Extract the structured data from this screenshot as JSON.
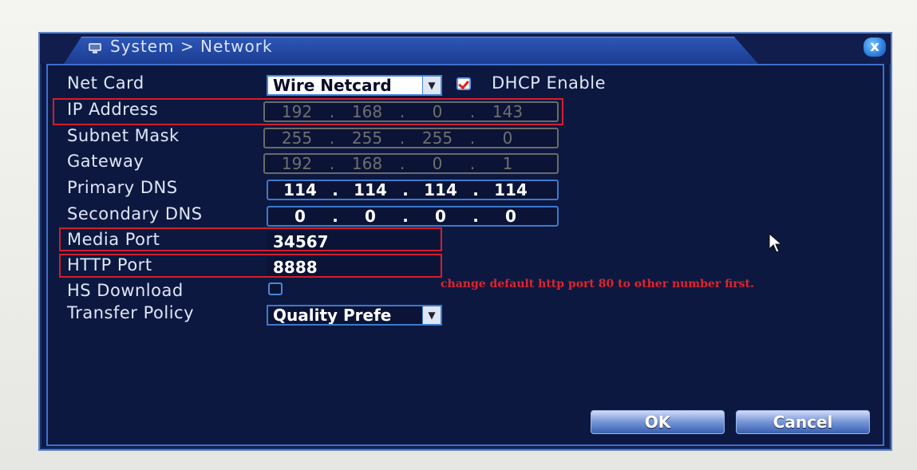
{
  "window": {
    "title": "System > Network",
    "close_label": "x"
  },
  "form": {
    "net_card": {
      "label": "Net Card",
      "value": "Wire Netcard",
      "dhcp_label": "DHCP Enable",
      "dhcp_checked": true
    },
    "ip_address": {
      "label": "IP Address",
      "octets": [
        "192",
        "168",
        "0",
        "143"
      ]
    },
    "subnet_mask": {
      "label": "Subnet Mask",
      "octets": [
        "255",
        "255",
        "255",
        "0"
      ]
    },
    "gateway": {
      "label": "Gateway",
      "octets": [
        "192",
        "168",
        "0",
        "1"
      ]
    },
    "primary_dns": {
      "label": "Primary DNS",
      "octets": [
        "114",
        "114",
        "114",
        "114"
      ]
    },
    "secondary_dns": {
      "label": "Secondary DNS",
      "octets": [
        "0",
        "0",
        "0",
        "0"
      ]
    },
    "media_port": {
      "label": "Media Port",
      "value": "34567"
    },
    "http_port": {
      "label": "HTTP Port",
      "value": "8888"
    },
    "hs_download": {
      "label": "HS Download",
      "checked": false
    },
    "transfer_policy": {
      "label": "Transfer Policy",
      "value": "Quality Prefe"
    }
  },
  "annotation": {
    "note": "change default http port 80 to other number first.",
    "color": "#d41e2a"
  },
  "buttons": {
    "ok": "OK",
    "cancel": "Cancel"
  }
}
